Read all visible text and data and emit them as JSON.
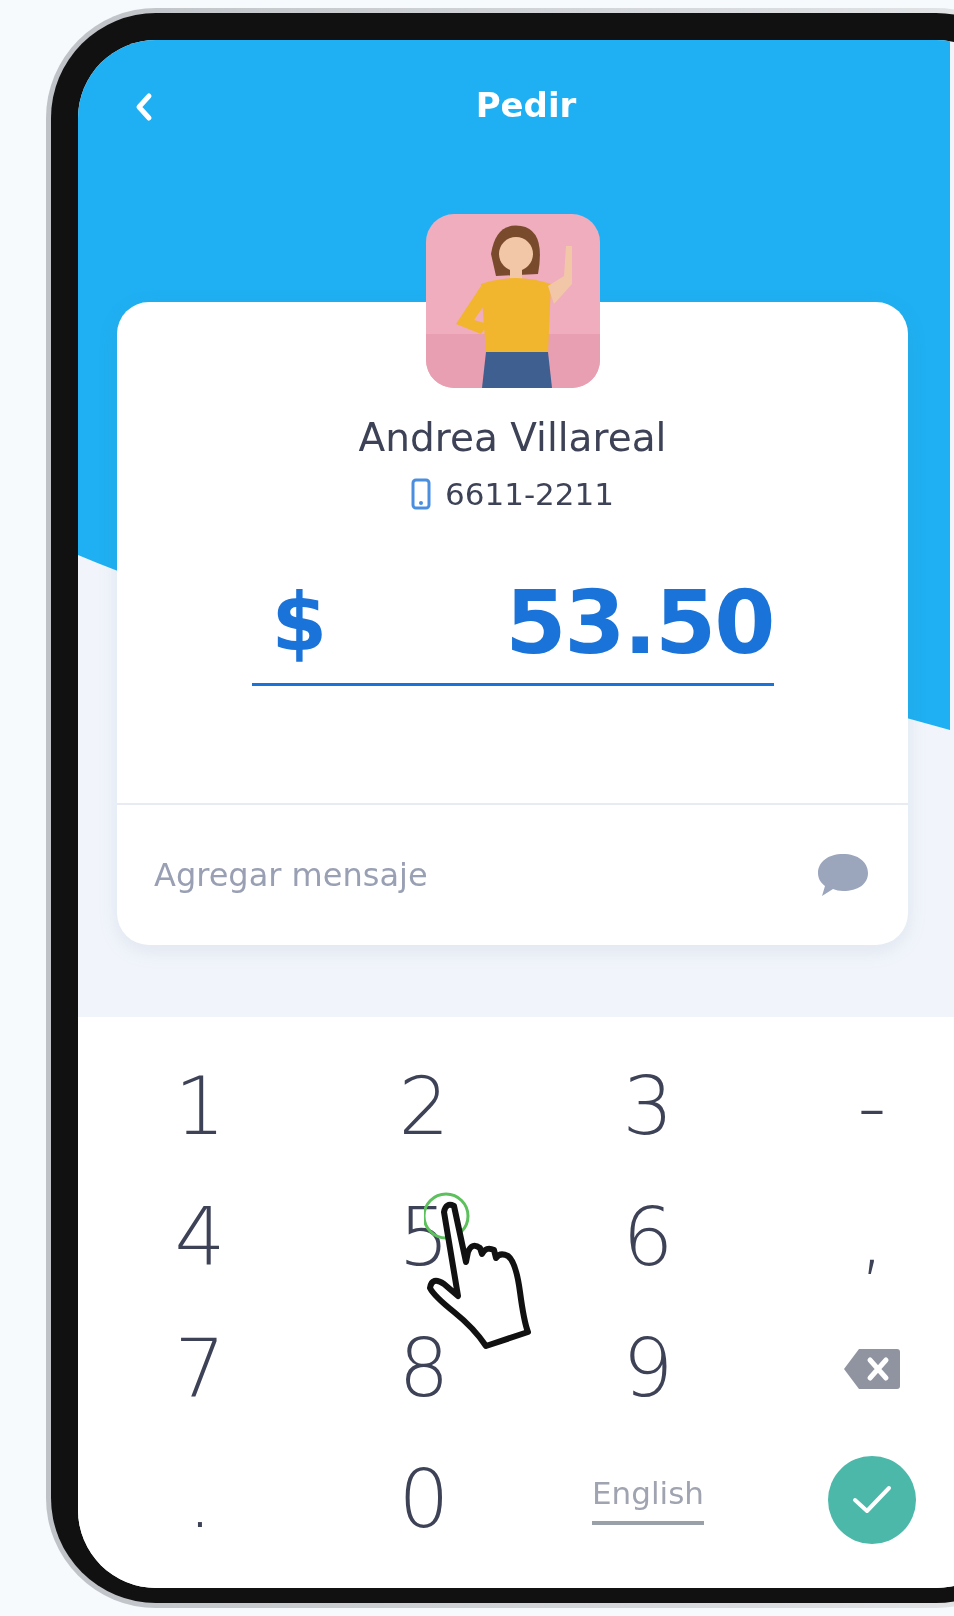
{
  "header": {
    "title": "Pedir"
  },
  "contact": {
    "name": "Andrea Villareal",
    "phone": "6611-2211"
  },
  "amount": {
    "currency": "$",
    "value": "53.50"
  },
  "message": {
    "placeholder": "Agregar mensaje"
  },
  "keypad": {
    "keys": [
      {
        "kind": "text",
        "label": "1"
      },
      {
        "kind": "text",
        "label": "2"
      },
      {
        "kind": "text",
        "label": "3"
      },
      {
        "kind": "text",
        "label": "-"
      },
      {
        "kind": "text",
        "label": "4"
      },
      {
        "kind": "text",
        "label": "5"
      },
      {
        "kind": "text",
        "label": "6"
      },
      {
        "kind": "text",
        "label": ","
      },
      {
        "kind": "text",
        "label": "7"
      },
      {
        "kind": "text",
        "label": "8"
      },
      {
        "kind": "text",
        "label": "9"
      },
      {
        "kind": "backspace"
      },
      {
        "kind": "text",
        "label": "."
      },
      {
        "kind": "text",
        "label": "0"
      },
      {
        "kind": "language",
        "label": "English"
      },
      {
        "kind": "confirm"
      }
    ]
  }
}
